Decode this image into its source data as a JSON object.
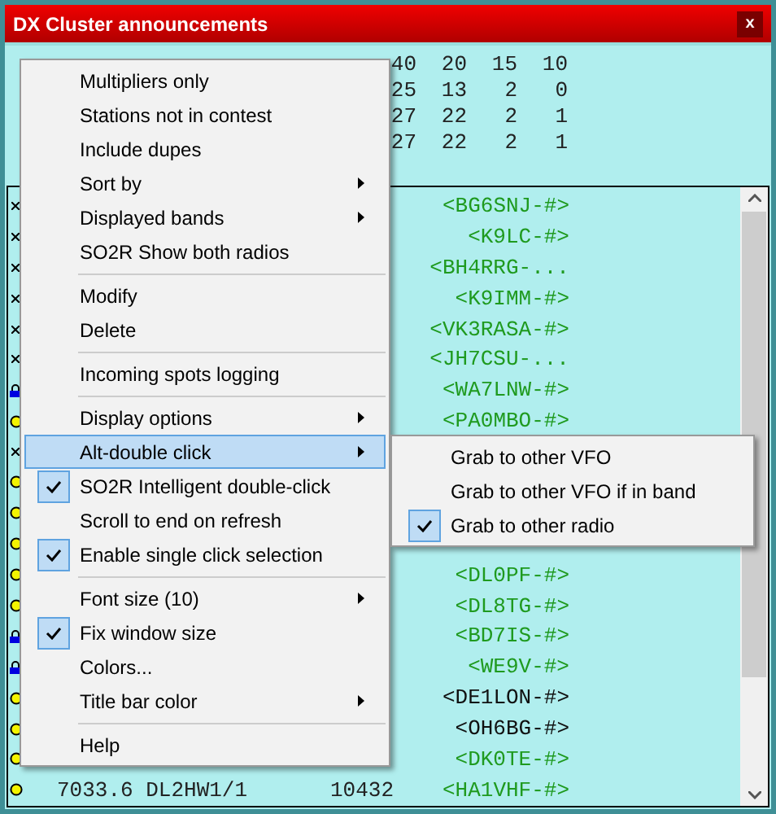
{
  "window": {
    "title": "DX Cluster announcements",
    "close": "x"
  },
  "summary": {
    "columns": [
      "40",
      "20",
      "15",
      "10"
    ],
    "rows": [
      [
        "25",
        "13",
        "2",
        "0"
      ],
      [
        "27",
        "22",
        "2",
        "1"
      ],
      [
        "27",
        "22",
        "2",
        "1"
      ]
    ]
  },
  "spots": [
    {
      "kind": "x",
      "call": "<BG6SNJ-#>",
      "color": "#1f9a1f"
    },
    {
      "kind": "x",
      "call": "<K9LC-#>",
      "color": "#1f9a1f"
    },
    {
      "kind": "x",
      "call": "<BH4RRG-...",
      "color": "#1f9a1f"
    },
    {
      "kind": "x",
      "call": "<K9IMM-#>",
      "color": "#1f9a1f"
    },
    {
      "kind": "x",
      "call": "<VK3RASA-#>",
      "color": "#1f9a1f"
    },
    {
      "kind": "x",
      "call": "<JH7CSU-...",
      "color": "#1f9a1f"
    },
    {
      "kind": "lock",
      "call": "<WA7LNW-#>",
      "color": "#1f9a1f"
    },
    {
      "kind": "dot",
      "call": "<PA0MBO-#>",
      "color": "#1f9a1f"
    },
    {
      "kind": "x"
    },
    {
      "kind": "dot"
    },
    {
      "kind": "dot"
    },
    {
      "kind": "dot"
    },
    {
      "kind": "dot",
      "call": "<DL0PF-#>",
      "color": "#1f9a1f"
    },
    {
      "kind": "dot",
      "call": "<DL8TG-#>",
      "color": "#1f9a1f"
    },
    {
      "kind": "lock",
      "call": "<BD7IS-#>",
      "color": "#1f9a1f"
    },
    {
      "kind": "lock",
      "call": "<WE9V-#>",
      "color": "#1f9a1f"
    },
    {
      "kind": "dot",
      "call": "<DE1LON-#>",
      "color": "#101010"
    },
    {
      "kind": "dot",
      "call": "<OH6BG-#>",
      "color": "#101010"
    },
    {
      "kind": "dot",
      "call": "<DK0TE-#>",
      "color": "#1f9a1f"
    },
    {
      "kind": "dot",
      "call": "<HA1VHF-#>",
      "color": "#1f9a1f",
      "freq": "7033.6 DL2HW1/1",
      "time": "10432"
    }
  ],
  "context_menu": [
    {
      "kind": "item",
      "label": "Multipliers only",
      "checked": false,
      "submenu": false,
      "selected": false
    },
    {
      "kind": "item",
      "label": "Stations not in contest",
      "checked": false,
      "submenu": false,
      "selected": false
    },
    {
      "kind": "item",
      "label": "Include dupes",
      "checked": false,
      "submenu": false,
      "selected": false
    },
    {
      "kind": "item",
      "label": "Sort by",
      "checked": false,
      "submenu": true,
      "selected": false
    },
    {
      "kind": "item",
      "label": "Displayed bands",
      "checked": false,
      "submenu": true,
      "selected": false
    },
    {
      "kind": "item",
      "label": "SO2R Show both radios",
      "checked": false,
      "submenu": false,
      "selected": false
    },
    {
      "kind": "separator"
    },
    {
      "kind": "item",
      "label": "Modify",
      "checked": false,
      "submenu": false,
      "selected": false
    },
    {
      "kind": "item",
      "label": "Delete",
      "checked": false,
      "submenu": false,
      "selected": false
    },
    {
      "kind": "separator"
    },
    {
      "kind": "item",
      "label": "Incoming spots logging",
      "checked": false,
      "submenu": false,
      "selected": false
    },
    {
      "kind": "separator"
    },
    {
      "kind": "item",
      "label": "Display options",
      "checked": false,
      "submenu": true,
      "selected": false
    },
    {
      "kind": "item",
      "label": "Alt-double click",
      "checked": false,
      "submenu": true,
      "selected": true
    },
    {
      "kind": "item",
      "label": "SO2R Intelligent double-click",
      "checked": true,
      "submenu": false,
      "selected": false
    },
    {
      "kind": "item",
      "label": "Scroll to end on refresh",
      "checked": false,
      "submenu": false,
      "selected": false
    },
    {
      "kind": "item",
      "label": "Enable single click selection",
      "checked": true,
      "submenu": false,
      "selected": false
    },
    {
      "kind": "separator"
    },
    {
      "kind": "item",
      "label": "Font size (10)",
      "checked": false,
      "submenu": true,
      "selected": false
    },
    {
      "kind": "item",
      "label": "Fix window size",
      "checked": true,
      "submenu": false,
      "selected": false
    },
    {
      "kind": "item",
      "label": "Colors...",
      "checked": false,
      "submenu": false,
      "selected": false
    },
    {
      "kind": "item",
      "label": "Title bar color",
      "checked": false,
      "submenu": true,
      "selected": false
    },
    {
      "kind": "separator"
    },
    {
      "kind": "item",
      "label": "Help",
      "checked": false,
      "submenu": false,
      "selected": false
    }
  ],
  "submenu": [
    {
      "label": "Grab to other VFO",
      "checked": false
    },
    {
      "label": "Grab to other VFO if in band",
      "checked": false
    },
    {
      "label": "Grab to other radio",
      "checked": true
    }
  ]
}
